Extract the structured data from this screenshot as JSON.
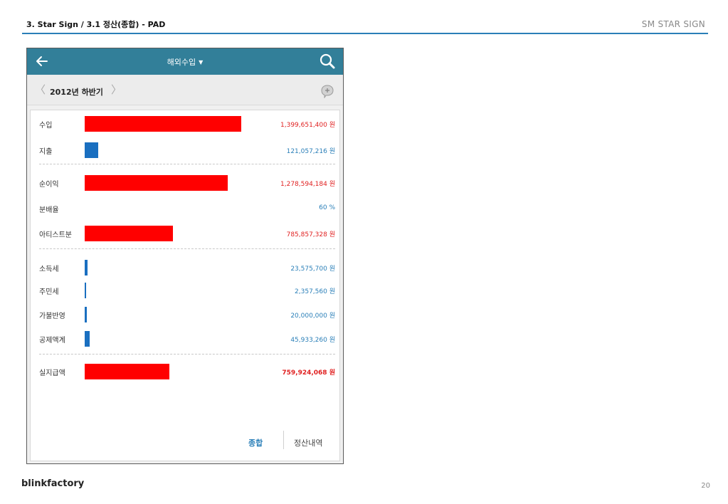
{
  "page": {
    "title": "3. Star Sign / 3.1 정산(종합) - PAD",
    "brand": "SM STAR SIGN",
    "footer_logo": "blinkfactory",
    "page_number": "20"
  },
  "appbar": {
    "title": "해외수입",
    "back_icon": "arrow-left-icon",
    "caret_icon": "▼",
    "search_icon": "search-icon"
  },
  "period": {
    "label": "2012년 하반기",
    "prev_icon": "〈",
    "next_icon": "〉",
    "comment_icon": "speech-bubble-plus-icon"
  },
  "colors": {
    "accent_blue": "#2a7fb8",
    "bar_red": "#ff0000",
    "bar_blue": "#1a6fc0",
    "appbar": "#327f99"
  },
  "rows": [
    {
      "label": "수입",
      "value": "1,399,651,400 원",
      "amount": 1399651400,
      "color": "red"
    },
    {
      "label": "지출",
      "value": "121,057,216 원",
      "amount": 121057216,
      "color": "blue"
    },
    {
      "label": "순이익",
      "value": "1,278,594,184 원",
      "amount": 1278594184,
      "color": "red"
    },
    {
      "label": "분배율",
      "value": "60 %",
      "amount": null,
      "color": "blue"
    },
    {
      "label": "아티스트분",
      "value": "785,857,328 원",
      "amount": 785857328,
      "color": "red"
    },
    {
      "label": "소득세",
      "value": "23,575,700 원",
      "amount": 23575700,
      "color": "blue"
    },
    {
      "label": "주민세",
      "value": "2,357,560 원",
      "amount": 2357560,
      "color": "blue"
    },
    {
      "label": "가불반영",
      "value": "20,000,000 원",
      "amount": 20000000,
      "color": "blue"
    },
    {
      "label": "공제액계",
      "value": "45,933,260 원",
      "amount": 45933260,
      "color": "blue"
    },
    {
      "label": "실지급액",
      "value": "759,924,068 원",
      "amount": 759924068,
      "color": "red",
      "emphasis": true
    }
  ],
  "tabs": {
    "summary": "종합",
    "detail": "정산내역"
  }
}
